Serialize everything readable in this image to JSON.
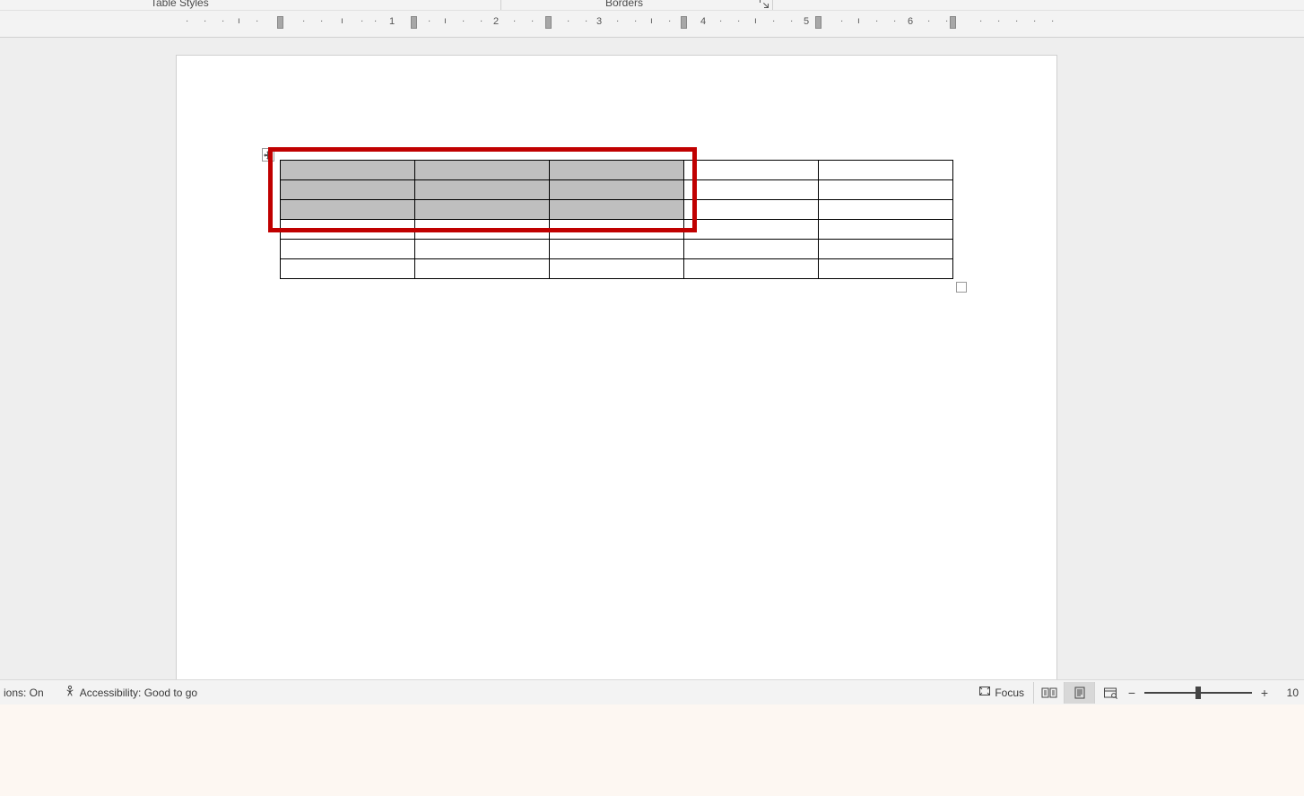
{
  "ribbon": {
    "group_table_styles": "Table Styles",
    "group_borders": "Borders"
  },
  "ruler": {
    "numbers": [
      "1",
      "2",
      "3",
      "4",
      "5",
      "6"
    ]
  },
  "table": {
    "rows": 6,
    "cols": 5,
    "selected_rows": [
      0,
      1,
      2
    ],
    "selected_cols": [
      0,
      1,
      2
    ]
  },
  "statusbar": {
    "predictions_suffix": "ions: On",
    "accessibility": "Accessibility: Good to go",
    "focus": "Focus",
    "zoom_value": "10",
    "zoom_thumb_pct": 50
  }
}
